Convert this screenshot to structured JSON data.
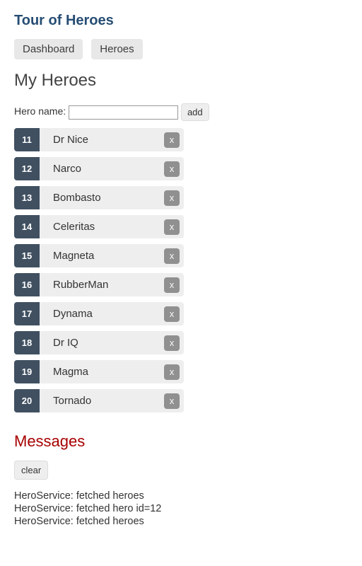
{
  "app": {
    "title": "Tour of Heroes"
  },
  "nav": {
    "dashboard": "Dashboard",
    "heroes": "Heroes"
  },
  "heroesSection": {
    "title": "My Heroes",
    "addLabel": "Hero name:",
    "addButton": "add",
    "inputValue": ""
  },
  "heroes": [
    {
      "id": "11",
      "name": "Dr Nice"
    },
    {
      "id": "12",
      "name": "Narco"
    },
    {
      "id": "13",
      "name": "Bombasto"
    },
    {
      "id": "14",
      "name": "Celeritas"
    },
    {
      "id": "15",
      "name": "Magneta"
    },
    {
      "id": "16",
      "name": "RubberMan"
    },
    {
      "id": "17",
      "name": "Dynama"
    },
    {
      "id": "18",
      "name": "Dr IQ"
    },
    {
      "id": "19",
      "name": "Magma"
    },
    {
      "id": "20",
      "name": "Tornado"
    }
  ],
  "deleteLabel": "x",
  "messagesSection": {
    "title": "Messages",
    "clearButton": "clear"
  },
  "messages": [
    "HeroService: fetched heroes",
    "HeroService: fetched hero id=12",
    "HeroService: fetched heroes"
  ]
}
